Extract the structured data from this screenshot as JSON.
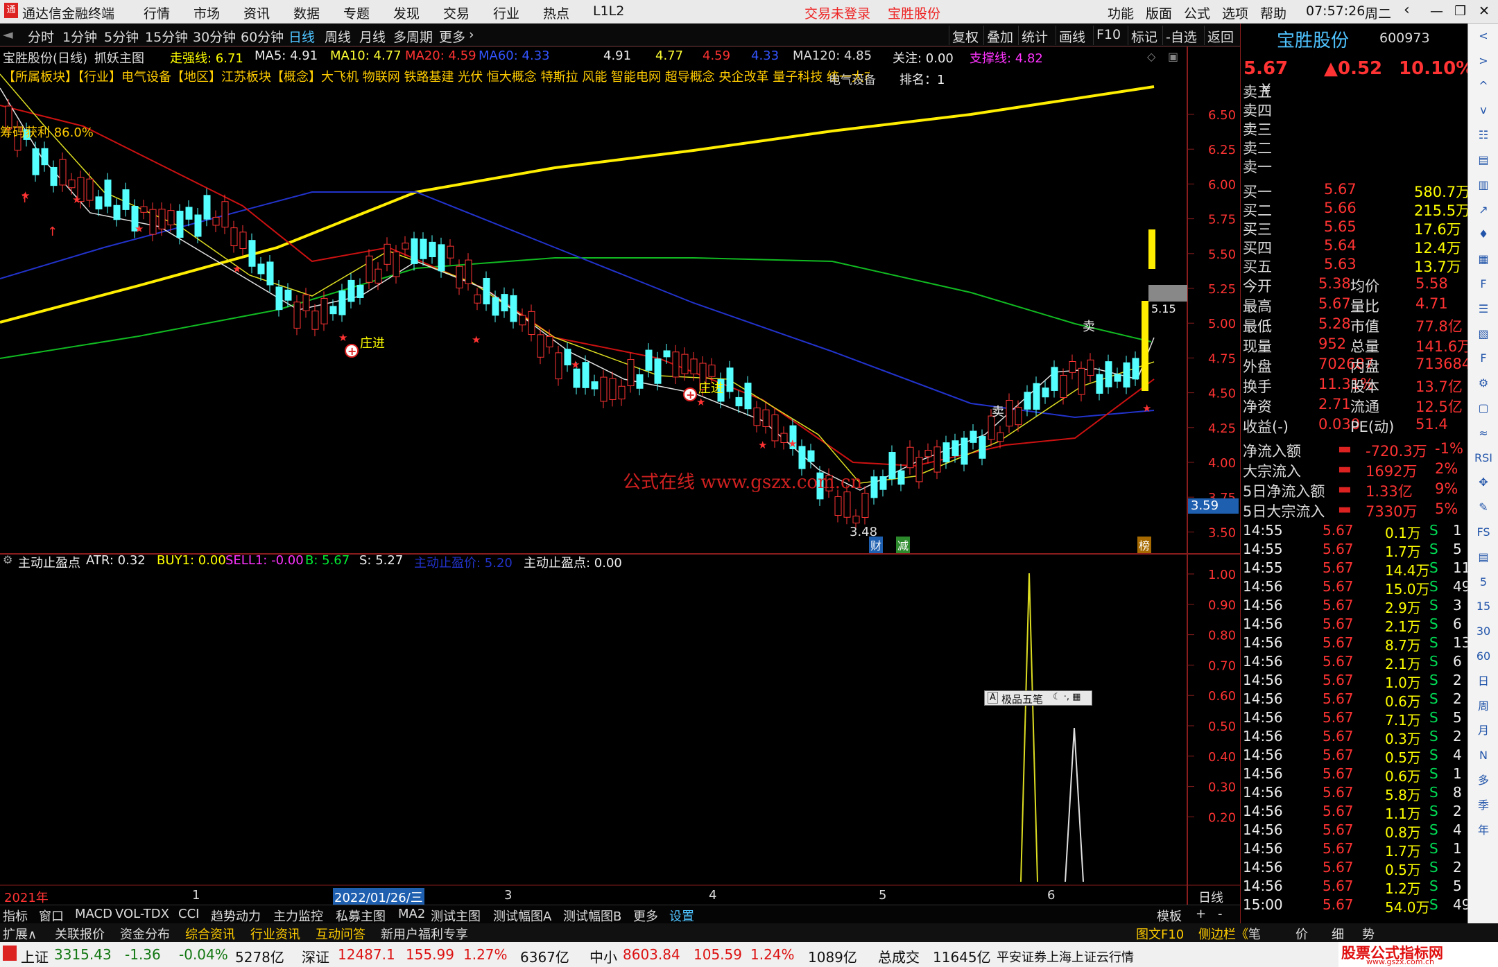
{
  "titlebar": {
    "app": "通达信金融终端",
    "menu": [
      "行情",
      "市场",
      "资讯",
      "数据",
      "专题",
      "发现",
      "交易",
      "行业",
      "热点",
      "L1L2"
    ],
    "login": "交易未登录",
    "stock": "宝胜股份",
    "right": [
      "功能",
      "版面",
      "公式",
      "选项",
      "帮助"
    ],
    "time": "07:57:26",
    "weekday": "周二"
  },
  "periods": [
    "分时",
    "1分钟",
    "5分钟",
    "15分钟",
    "30分钟",
    "60分钟",
    "日线",
    "周线",
    "月线",
    "多周期",
    "更多"
  ],
  "toolbar": [
    "复权",
    "叠加",
    "统计",
    "画线",
    "F10",
    "标记",
    "-自选",
    "返回"
  ],
  "main_header": {
    "name": "宝胜股份(日线)",
    "formula": "抓妖主图",
    "strong": "走强线: 6.71",
    "ma5": "MA5: 4.91",
    "ma10": "MA10: 4.77",
    "ma20": "MA20: 4.59",
    "ma60": "MA60: 4.33",
    "v1": "4.91",
    "v2": "4.77",
    "v3": "4.59",
    "v4": "4.33",
    "ma120": "MA120: 4.85",
    "focus": "关注: 0.00",
    "support": "支撑线: 4.82"
  },
  "concept_line": "【所属板块】【行业】电气设备【地区】江苏板块【概念】大飞机 物联网 铁路基建 光伏 恒大概念 特斯拉 风能 智能电网 超导概念 央企改革 量子科技 统一大市场",
  "rank": "排名：1",
  "industry_tag": "电气设备",
  "chart_labels": {
    "profit": "筹码获利 86.0%",
    "zhuangjin": "庄进",
    "sell": "卖",
    "watermark": "公式在线  www.gszx.com.cn",
    "low": "3.48",
    "box": "5.15",
    "cursor_price": "3.59",
    "cai": "财",
    "jian": "减",
    "bang": "榜"
  },
  "price_axis": [
    "6.50",
    "6.25",
    "6.00",
    "5.75",
    "5.50",
    "5.25",
    "5.00",
    "4.75",
    "4.50",
    "4.25",
    "4.00",
    "3.75",
    "3.50"
  ],
  "sub_header": {
    "name": "主动止盈点",
    "atr": "ATR: 0.32",
    "buy1": "BUY1: 0.00",
    "sell1": "SELL1: -0.00",
    "b": "B: 5.67",
    "s": "S: 5.27",
    "zp": "主动止盈价: 5.20",
    "zd": "主动止盈点: 0.00"
  },
  "sub_axis": [
    "1.00",
    "0.90",
    "0.80",
    "0.70",
    "0.60",
    "0.50",
    "0.40",
    "0.30",
    "0.20"
  ],
  "ime": "极品五笔",
  "date_axis": {
    "y2021": "2021年",
    "m1": "1",
    "cursor_date": "2022/01/26/三",
    "m3": "3",
    "m4": "4",
    "m5": "5",
    "m6": "6",
    "dayline": "日线"
  },
  "tabs1": [
    "指标",
    "窗口",
    "MACD",
    "VOL-TDX",
    "CCI",
    "趋势动力",
    "主力监控",
    "私募主图",
    "MA2",
    "测试主图",
    "测试幅图A",
    "测试幅图B",
    "更多",
    "设置"
  ],
  "tabs1_right": [
    "模板",
    "+",
    "-"
  ],
  "tabs2": [
    "扩展∧",
    "关联报价",
    "资金分布",
    "综合资讯",
    "行业资讯",
    "互动问答",
    "新用户福利专享"
  ],
  "tabs2_right": [
    "图文F10",
    "侧边栏《",
    "笔",
    "价",
    "细",
    "势"
  ],
  "quote": {
    "name": "宝胜股份",
    "code": "600973",
    "price": "5.67",
    "change": "▲0.52",
    "pct": "10.10%",
    "sell": [
      {
        "l": "卖五",
        "p": "",
        "v": "¥"
      },
      {
        "l": "卖四",
        "p": "",
        "v": ""
      },
      {
        "l": "卖三",
        "p": "",
        "v": ""
      },
      {
        "l": "卖二",
        "p": "",
        "v": ""
      },
      {
        "l": "卖一",
        "p": "",
        "v": ""
      }
    ],
    "buy": [
      {
        "l": "买一",
        "p": "5.67",
        "v": "580.7万"
      },
      {
        "l": "买二",
        "p": "5.66",
        "v": "215.5万"
      },
      {
        "l": "买三",
        "p": "5.65",
        "v": "17.6万"
      },
      {
        "l": "买四",
        "p": "5.64",
        "v": "12.4万"
      },
      {
        "l": "买五",
        "p": "5.63",
        "v": "13.7万"
      }
    ],
    "stats": [
      {
        "a": "今开",
        "av": "5.38",
        "b": "均价",
        "bv": "5.58"
      },
      {
        "a": "最高",
        "av": "5.67",
        "b": "量比",
        "bv": "4.71"
      },
      {
        "a": "最低",
        "av": "5.28",
        "b": "市值",
        "bv": "77.8亿"
      },
      {
        "a": "现量",
        "av": "952",
        "b": "总量",
        "bv": "141.6万"
      },
      {
        "a": "外盘",
        "av": "702687",
        "b": "内盘",
        "bv": "713684"
      },
      {
        "a": "换手",
        "av": "11.31%",
        "b": "股本",
        "bv": "13.7亿"
      },
      {
        "a": "净资",
        "av": "2.71",
        "b": "流通",
        "bv": "12.5亿"
      },
      {
        "a": "收益(-)",
        "av": "0.030",
        "b": "PE(动)",
        "bv": "51.4"
      }
    ],
    "flows": [
      {
        "l": "净流入额",
        "v": "-720.3万",
        "p": "-1%"
      },
      {
        "l": "大宗流入",
        "v": "1692万",
        "p": "2%"
      },
      {
        "l": "5日净流入额",
        "v": "1.33亿",
        "p": "9%"
      },
      {
        "l": "5日大宗流入",
        "v": "7330万",
        "p": "5%"
      }
    ]
  },
  "ticks": [
    {
      "t": "14:55",
      "p": "5.67",
      "v": "0.1万",
      "n": "1"
    },
    {
      "t": "14:55",
      "p": "5.67",
      "v": "1.7万",
      "n": "5"
    },
    {
      "t": "14:55",
      "p": "5.67",
      "v": "14.4万",
      "n": "11"
    },
    {
      "t": "14:56",
      "p": "5.67",
      "v": "15.0万",
      "n": "49"
    },
    {
      "t": "14:56",
      "p": "5.67",
      "v": "2.9万",
      "n": "3"
    },
    {
      "t": "14:56",
      "p": "5.67",
      "v": "2.1万",
      "n": "6"
    },
    {
      "t": "14:56",
      "p": "5.67",
      "v": "8.7万",
      "n": "13"
    },
    {
      "t": "14:56",
      "p": "5.67",
      "v": "2.1万",
      "n": "6"
    },
    {
      "t": "14:56",
      "p": "5.67",
      "v": "1.0万",
      "n": "2"
    },
    {
      "t": "14:56",
      "p": "5.67",
      "v": "0.6万",
      "n": "2"
    },
    {
      "t": "14:56",
      "p": "5.67",
      "v": "7.1万",
      "n": "5"
    },
    {
      "t": "14:56",
      "p": "5.67",
      "v": "0.3万",
      "n": "2"
    },
    {
      "t": "14:56",
      "p": "5.67",
      "v": "0.5万",
      "n": "4"
    },
    {
      "t": "14:56",
      "p": "5.67",
      "v": "0.6万",
      "n": "1"
    },
    {
      "t": "14:56",
      "p": "5.67",
      "v": "5.8万",
      "n": "8"
    },
    {
      "t": "14:56",
      "p": "5.67",
      "v": "1.1万",
      "n": "2"
    },
    {
      "t": "14:56",
      "p": "5.67",
      "v": "0.8万",
      "n": "4"
    },
    {
      "t": "14:56",
      "p": "5.67",
      "v": "1.7万",
      "n": "1"
    },
    {
      "t": "14:56",
      "p": "5.67",
      "v": "0.5万",
      "n": "2"
    },
    {
      "t": "14:56",
      "p": "5.67",
      "v": "1.2万",
      "n": "5"
    },
    {
      "t": "15:00",
      "p": "5.67",
      "v": "54.0万",
      "n": "49"
    }
  ],
  "tick_flag": "S",
  "sidebar_icons": [
    "<",
    ">",
    "^",
    "v",
    "☷",
    "▤",
    "▥",
    "↗",
    "♦",
    "▦",
    "F",
    "☰",
    "▧",
    "F",
    "⚙",
    "▢",
    "≈",
    "RSI",
    "✥",
    "✎",
    "FS",
    "▤",
    "5",
    "15",
    "30",
    "60",
    "日",
    "周",
    "月",
    "N",
    "多",
    "季",
    "年"
  ],
  "status": {
    "sh": "上证",
    "sh_v": "3315.43",
    "sh_c": "-1.36",
    "sh_p": "-0.04%",
    "sh_a": "5278亿",
    "sz": "深证",
    "sz_v": "12487.1",
    "sz_c": "155.99",
    "sz_p": "1.27%",
    "sz_a": "6367亿",
    "zx": "中小",
    "zx_v": "8603.84",
    "zx_c": "105.59",
    "zx_p": "1.24%",
    "zx_a": "1089亿",
    "total": "总成交",
    "total_v": "11645亿",
    "broker": "平安证券上海上证云行情",
    "logo": "股票公式指标网",
    "logo_url": "www.gszx.com.cn"
  }
}
